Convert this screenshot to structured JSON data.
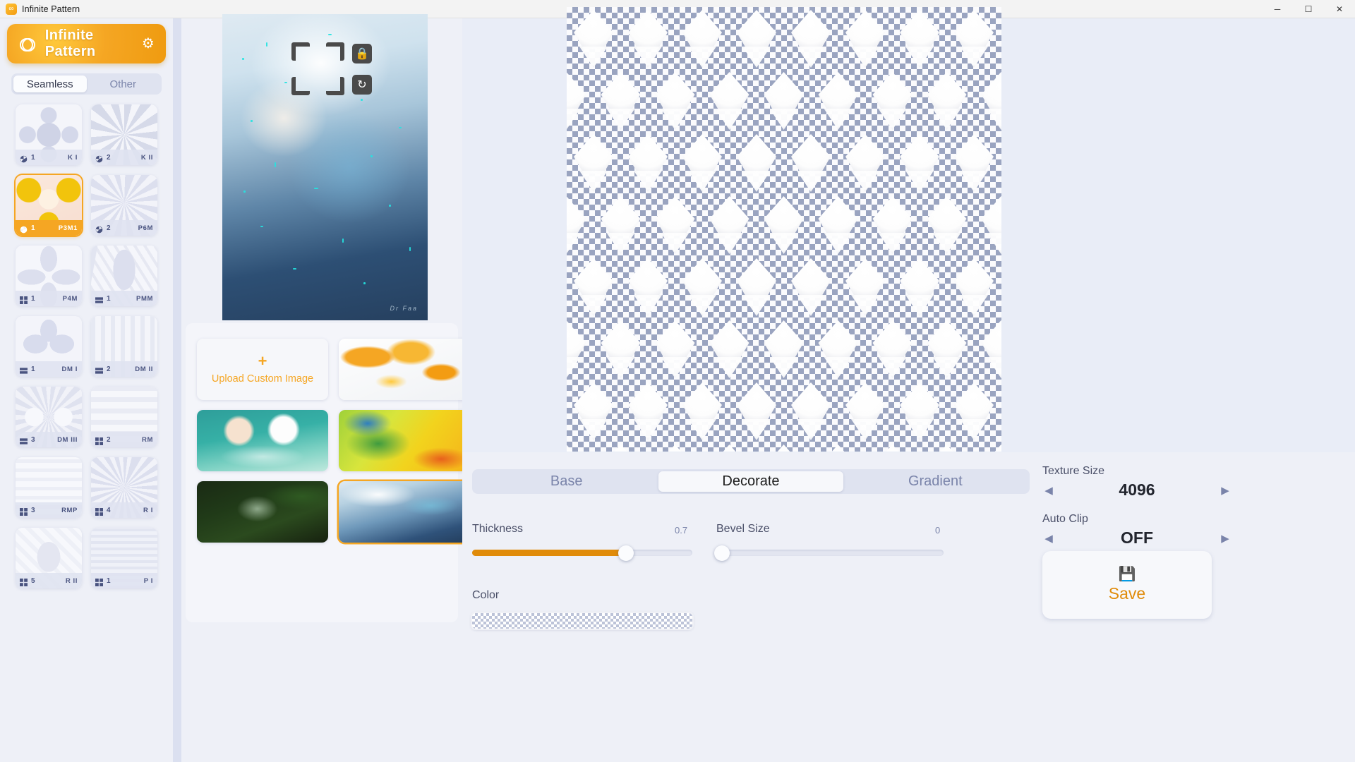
{
  "window": {
    "title": "Infinite Pattern",
    "icon": "app-logo-icon",
    "minimize": "─",
    "maximize": "☐",
    "close": "✕"
  },
  "sidebar": {
    "brand_title": "Infinite Pattern",
    "brand_logo": "infinity-loops-icon",
    "settings_icon": "gear-icon",
    "tabs": [
      {
        "label": "Seamless",
        "active": true
      },
      {
        "label": "Other",
        "active": false
      }
    ],
    "patterns": [
      {
        "num": "1",
        "code": "K I",
        "sym": "rotation",
        "selected": false
      },
      {
        "num": "2",
        "code": "K II",
        "sym": "rotation",
        "selected": false
      },
      {
        "num": "1",
        "code": "P3M1",
        "sym": "rotation",
        "selected": true
      },
      {
        "num": "2",
        "code": "P6M",
        "sym": "rotation",
        "selected": false
      },
      {
        "num": "1",
        "code": "P4M",
        "sym": "grid",
        "selected": false
      },
      {
        "num": "1",
        "code": "PMM",
        "sym": "bars",
        "selected": false
      },
      {
        "num": "1",
        "code": "DM I",
        "sym": "bars",
        "selected": false
      },
      {
        "num": "2",
        "code": "DM II",
        "sym": "bars",
        "selected": false
      },
      {
        "num": "3",
        "code": "DM III",
        "sym": "bars",
        "selected": false
      },
      {
        "num": "2",
        "code": "RM",
        "sym": "grid",
        "selected": false
      },
      {
        "num": "3",
        "code": "RMP",
        "sym": "grid",
        "selected": false
      },
      {
        "num": "4",
        "code": "R I",
        "sym": "grid",
        "selected": false
      },
      {
        "num": "5",
        "code": "R II",
        "sym": "grid",
        "selected": false
      },
      {
        "num": "1",
        "code": "P I",
        "sym": "grid",
        "selected": false
      }
    ]
  },
  "preview": {
    "signature": "Dr Faa",
    "crop": {
      "lock_icon": "lock-icon",
      "rotate_icon": "rotate-icon"
    }
  },
  "sources": {
    "upload": {
      "plus": "+",
      "label": "Upload Custom Image"
    },
    "tiles": [
      {
        "name": "orange-leaves-artwork",
        "selected": false
      },
      {
        "name": "two-bathers-artwork",
        "selected": false
      },
      {
        "name": "green-yellow-artwork",
        "selected": false
      },
      {
        "name": "dark-forest-artwork",
        "selected": false
      },
      {
        "name": "blue-character-artwork",
        "selected": true
      }
    ]
  },
  "controls": {
    "tabs": [
      {
        "label": "Base",
        "active": false
      },
      {
        "label": "Decorate",
        "active": true
      },
      {
        "label": "Gradient",
        "active": false
      }
    ],
    "thickness": {
      "label": "Thickness",
      "value": "0.7",
      "percent": 70
    },
    "bevel": {
      "label": "Bevel Size",
      "value": "0",
      "percent": 0
    },
    "color": {
      "label": "Color",
      "value": "transparent"
    },
    "texture_size": {
      "label": "Texture Size",
      "value": "4096",
      "left_arrow": "◀",
      "right_arrow": "▶"
    },
    "auto_clip": {
      "label": "Auto Clip",
      "value": "OFF",
      "left_arrow": "◀",
      "right_arrow": "▶"
    },
    "save": {
      "label": "Save",
      "icon": "floppy-disk-icon",
      "glyph": "💾"
    }
  },
  "colors": {
    "accent": "#f5a623",
    "accent_dark": "#e08b0a",
    "panel": "#eef0f7",
    "muted_text": "#7a84aa",
    "segment_bg": "#dfe3f0"
  }
}
